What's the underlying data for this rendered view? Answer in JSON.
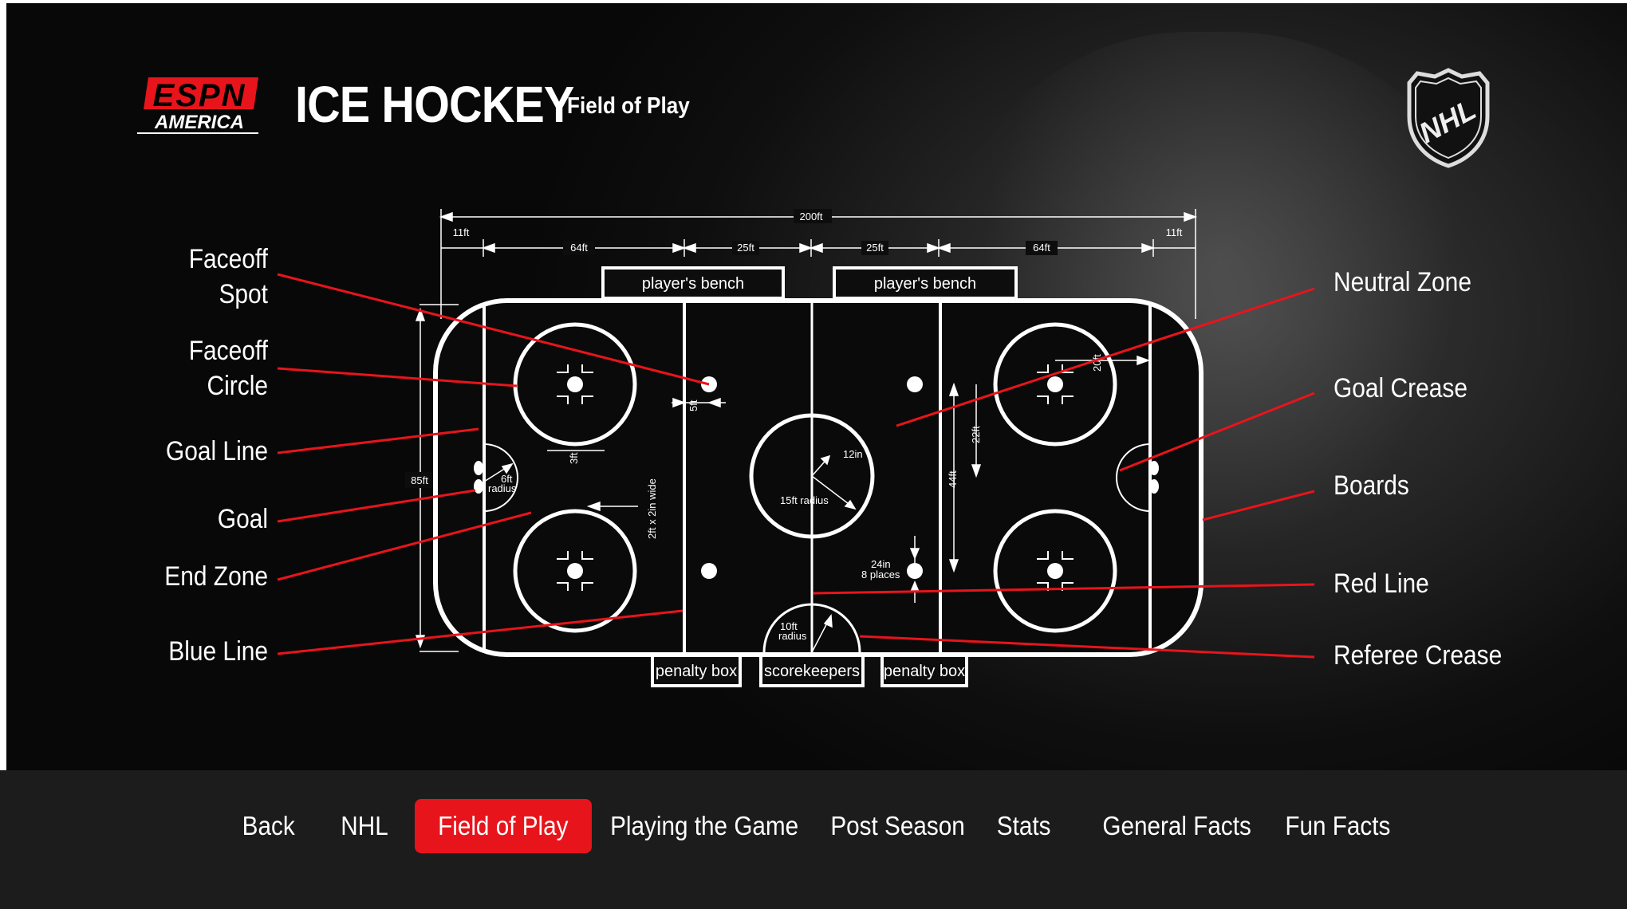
{
  "header": {
    "logo_text": "ESPN",
    "logo_subtext": "AMERICA",
    "title": "ICE HOCKEY",
    "subtitle": "Field of Play",
    "nhl_logo_text": "NHL"
  },
  "labels_left": [
    {
      "text": "Faceoff\nSpot",
      "id": "faceoff-spot"
    },
    {
      "text": "Faceoff\nCircle",
      "id": "faceoff-circle"
    },
    {
      "text": "Goal Line",
      "id": "goal-line"
    },
    {
      "text": "Goal",
      "id": "goal"
    },
    {
      "text": "End Zone",
      "id": "end-zone"
    },
    {
      "text": "Blue Line",
      "id": "blue-line"
    }
  ],
  "labels_right": [
    {
      "text": "Neutral Zone",
      "id": "neutral-zone"
    },
    {
      "text": "Goal Crease",
      "id": "goal-crease"
    },
    {
      "text": "Boards",
      "id": "boards"
    },
    {
      "text": "Red Line",
      "id": "red-line"
    },
    {
      "text": "Referee Crease",
      "id": "referee-crease"
    }
  ],
  "dimensions": {
    "total_length": "200ft",
    "end_space_left": "11ft",
    "end_space_right": "11ft",
    "zone_left": "64ft",
    "zone_right": "64ft",
    "neutral_left": "25ft",
    "neutral_right": "25ft",
    "width": "85ft",
    "goal_crease_radius": "6ft\nradius",
    "spot_offset": "3ft",
    "spot_distance": "5ft",
    "blue_line_width": "2ft x 2in wide",
    "center_dot": "12in",
    "center_radius": "15ft radius",
    "referee_radius": "10ft\nradius",
    "neutral_spot": "24in\n8 places",
    "circle_offset": "22ft",
    "circle_spacing": "44ft",
    "circle_to_board": "20ft"
  },
  "boxes": {
    "bench_left": "player's bench",
    "bench_right": "player's bench",
    "penalty_left": "penalty box",
    "scorekeepers": "scorekeepers",
    "penalty_right": "penalty box"
  },
  "nav": {
    "items": [
      {
        "label": "Back",
        "active": false
      },
      {
        "label": "NHL",
        "active": false
      },
      {
        "label": "Field of Play",
        "active": true
      },
      {
        "label": "Playing the Game",
        "active": false
      },
      {
        "label": "Post Season",
        "active": false
      },
      {
        "label": "Stats",
        "active": false
      },
      {
        "label": "General Facts",
        "active": false
      },
      {
        "label": "Fun Facts",
        "active": false
      }
    ]
  },
  "colors": {
    "accent": "#e8141b",
    "rink_lines": "#ffffff",
    "pointer_lines": "#e8141b"
  }
}
